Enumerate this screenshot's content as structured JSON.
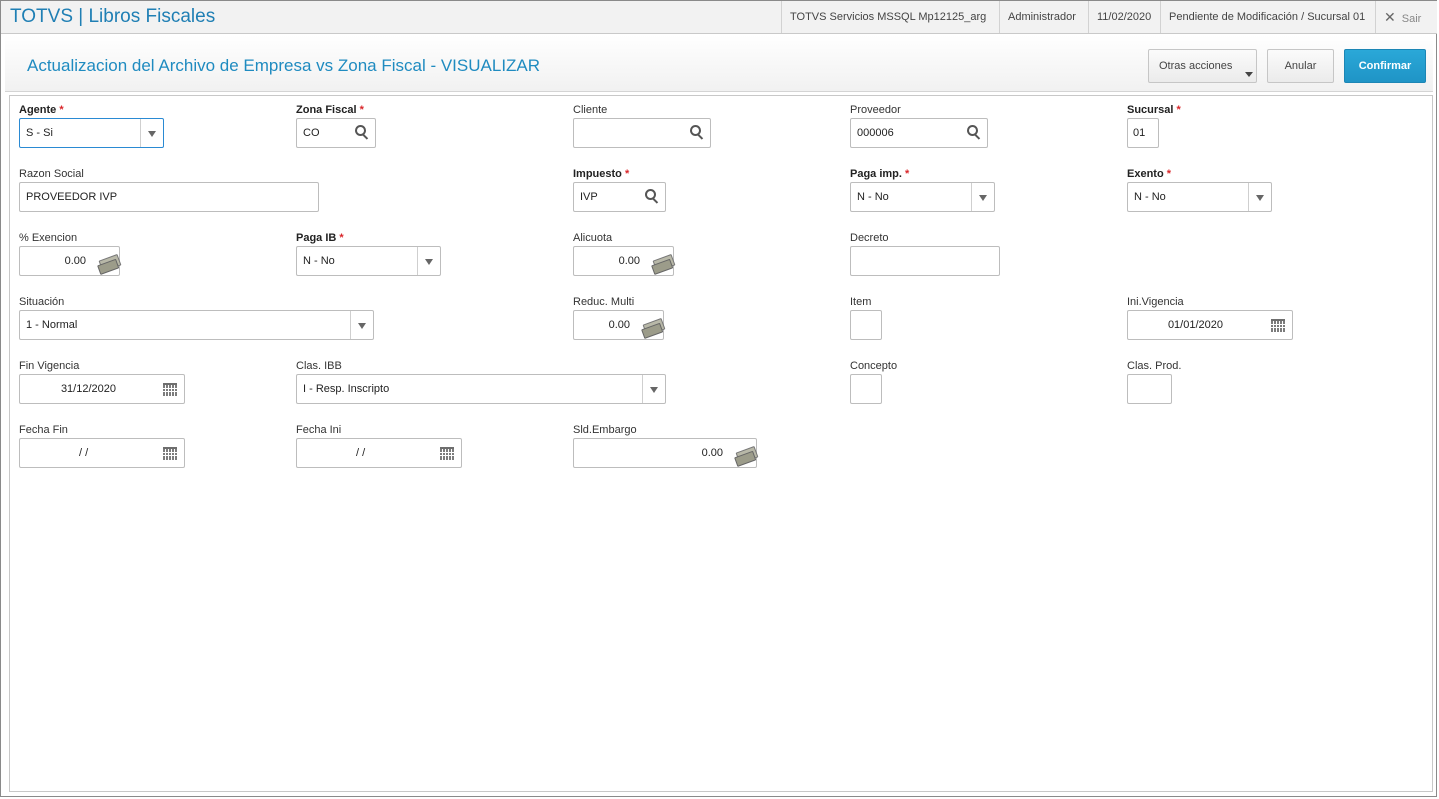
{
  "app": {
    "title": "TOTVS | Libros Fiscales"
  },
  "status": {
    "server": "TOTVS Servicios MSSQL Mp12125_arg",
    "user": "Administrador",
    "date": "11/02/2020",
    "branch": "Pendiente de Modificación / Sucursal 01",
    "exit": "Sair"
  },
  "header": {
    "title": "Actualizacion del Archivo de Empresa vs Zona Fiscal - VISUALIZAR",
    "other_actions": "Otras acciones",
    "cancel": "Anular",
    "confirm": "Confirmar"
  },
  "fields": {
    "agente": {
      "label": "Agente",
      "value": "S - Si"
    },
    "zona_fiscal": {
      "label": "Zona Fiscal",
      "value": "CO"
    },
    "cliente": {
      "label": "Cliente",
      "value": ""
    },
    "proveedor": {
      "label": "Proveedor",
      "value": "000006"
    },
    "sucursal": {
      "label": "Sucursal",
      "value": "01"
    },
    "razon_social": {
      "label": "Razon Social",
      "value": "PROVEEDOR IVP"
    },
    "impuesto": {
      "label": "Impuesto",
      "value": "IVP"
    },
    "paga_imp": {
      "label": "Paga imp.",
      "value": "N - No"
    },
    "exento": {
      "label": "Exento",
      "value": "N - No"
    },
    "exencion": {
      "label": "% Exencion",
      "value": "0.00"
    },
    "paga_ib": {
      "label": "Paga IB",
      "value": "N - No"
    },
    "alicuota": {
      "label": "Alicuota",
      "value": "0.00"
    },
    "decreto": {
      "label": "Decreto",
      "value": ""
    },
    "situacion": {
      "label": "Situación",
      "value": "1 - Normal"
    },
    "reduc_multi": {
      "label": "Reduc. Multi",
      "value": "0.00"
    },
    "item": {
      "label": "Item",
      "value": ""
    },
    "ini_vigencia": {
      "label": "Ini.Vigencia",
      "value": "01/01/2020"
    },
    "fin_vigencia": {
      "label": "Fin Vigencia",
      "value": "31/12/2020"
    },
    "clas_ibb": {
      "label": "Clas. IBB",
      "value": "I - Resp. Inscripto"
    },
    "concepto": {
      "label": "Concepto",
      "value": ""
    },
    "clas_prod": {
      "label": "Clas. Prod.",
      "value": ""
    },
    "fecha_fin": {
      "label": "Fecha Fin",
      "value": "/ /"
    },
    "fecha_ini": {
      "label": "Fecha Ini",
      "value": "/ /"
    },
    "sld_embargo": {
      "label": "Sld.Embargo",
      "value": "0.00"
    }
  },
  "required_marker": "*"
}
